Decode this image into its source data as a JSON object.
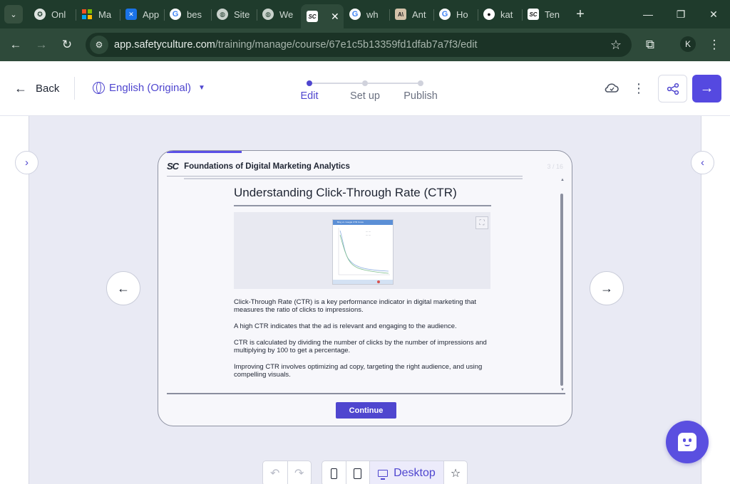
{
  "browser": {
    "tabs": [
      {
        "label": "Onl",
        "icon": "onl-icon"
      },
      {
        "label": "Ma",
        "icon": "ms-icon"
      },
      {
        "label": "App",
        "icon": "app-icon"
      },
      {
        "label": "bes",
        "icon": "google-icon"
      },
      {
        "label": "Site",
        "icon": "globe-icon"
      },
      {
        "label": "We",
        "icon": "globe-icon"
      },
      {
        "label": "",
        "icon": "safetyculture-icon",
        "active": true
      },
      {
        "label": "wh",
        "icon": "google-icon"
      },
      {
        "label": "Ant",
        "icon": "anthropic-icon"
      },
      {
        "label": "Ho",
        "icon": "google-icon"
      },
      {
        "label": "kat",
        "icon": "github-icon"
      },
      {
        "label": "Ten",
        "icon": "safetyculture-icon"
      }
    ],
    "url_host": "app.safetyculture.com",
    "url_path": "/training/manage/course/67e1c5b13359fd1dfab7a7f3/edit",
    "profile_initial": "K"
  },
  "header": {
    "back_label": "Back",
    "language_label": "English (Original)",
    "steps": [
      {
        "label": "Edit",
        "active": true
      },
      {
        "label": "Set up",
        "active": false
      },
      {
        "label": "Publish",
        "active": false
      }
    ]
  },
  "card": {
    "course_title": "Foundations of Digital Marketing Analytics",
    "page_count": "3 / 16",
    "lesson_heading": "Understanding Click-Through Rate (CTR)",
    "image_caption_header": "Bing vs. Google CTR Curve",
    "paragraphs": [
      "Click-Through Rate (CTR) is a key performance indicator in digital marketing that measures the ratio of clicks to impressions.",
      "A high CTR indicates that the ad is relevant and engaging to the audience.",
      "CTR is calculated by dividing the number of clicks by the number of impressions and multiplying by 100 to get a percentage.",
      "Improving CTR involves optimizing ad copy, targeting the right audience, and using compelling visuals."
    ],
    "continue_label": "Continue",
    "progress_fraction": 0.19
  },
  "toolbar": {
    "desktop_label": "Desktop"
  },
  "colors": {
    "accent": "#4f46cf",
    "browser_dark": "#1f3b2c",
    "canvas": "#e9eaf4"
  }
}
